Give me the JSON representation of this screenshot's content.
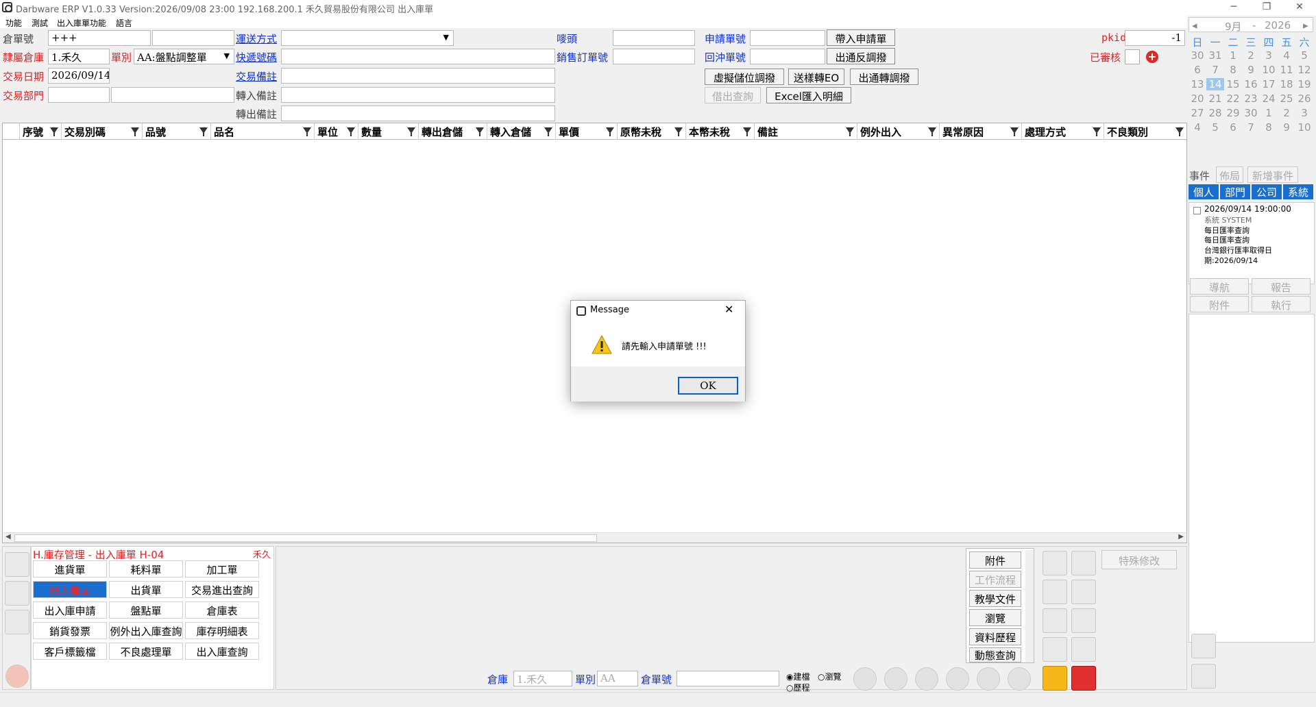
{
  "window": {
    "title": "Darbware ERP V1.0.33 Version:2026/09/08 23:00   192.168.200.1 禾久貿易股份有限公司 出入庫單",
    "minimize": "─",
    "restore": "❐",
    "close": "✕"
  },
  "menu": [
    "功能",
    "測試",
    "出入庫單功能",
    "語言"
  ],
  "form": {
    "warehouse_no_label": "倉單號",
    "warehouse_no_value": "+++",
    "warehouse_no_value2": "",
    "belong_wh_label": "隸屬倉庫",
    "belong_wh_value": "1.禾久",
    "doc_type_label": "單別",
    "doc_type_value": "AA:盤點調整單",
    "trade_date_label": "交易日期",
    "trade_date_value": "2026/09/14",
    "trade_dept_label": "交易部門",
    "trade_dept_value": "",
    "trade_dept_value2": "",
    "ship_method_label": "運送方式",
    "ship_method_value": "",
    "express_no_label": "快遞號碼",
    "express_no_value": "",
    "trade_note_label": "交易備註",
    "trade_note_value": "",
    "in_note_label": "轉入備註",
    "in_note_value": "",
    "out_note_label": "轉出備註",
    "out_note_value": "",
    "mark_label": "嘜頭",
    "mark_value": "",
    "sales_order_label": "銷售訂單號",
    "sales_order_value": "",
    "apply_no_label": "申請單號",
    "apply_no_value": "",
    "offset_no_label": "回沖單號",
    "offset_no_value": "",
    "pkid_label": "pkid",
    "pkid_value": "-1",
    "reviewed_label": "已審核",
    "btn_import_apply": "帶入申請單",
    "btn_out_reverse": "出通反調撥",
    "btn_virtual_store": "虛擬儲位調撥",
    "btn_sample_eo": "送樣轉EO",
    "btn_out_transfer": "出通轉調撥",
    "btn_lend_query": "借出查詢",
    "btn_excel_import": "Excel匯入明細"
  },
  "grid": {
    "columns": [
      "序號",
      "交易別碼",
      "品號",
      "品名",
      "單位",
      "數量",
      "轉出倉儲",
      "轉入倉儲",
      "單價",
      "原幣未稅",
      "本幣未稅",
      "備註",
      "例外出入",
      "異常原因",
      "處理方式",
      "不良類別"
    ]
  },
  "module": {
    "title": "H.庫存管理 - 出入庫單  H-04",
    "company": "禾久",
    "items": [
      "進貨單",
      "耗料單",
      "加工單",
      "出入庫單",
      "出貨單",
      "交易進出查詢",
      "出入庫申請",
      "盤點單",
      "倉庫表",
      "銷貨發票",
      "例外出入庫查詢",
      "庫存明細表",
      "客戶標籤檔",
      "不良處理單",
      "出入庫查詢"
    ]
  },
  "side_buttons": [
    "附件",
    "工作流程",
    "教學文件",
    "瀏覽",
    "資料歷程",
    "動態查詢"
  ],
  "special_edit": "特殊修改",
  "nav": {
    "wh_label": "倉庫",
    "wh_value": "1.禾久",
    "type_label": "單別",
    "type_value": "AA",
    "no_label": "倉單號",
    "no_value": "",
    "radio_current": "建檔",
    "radio_browse": "瀏覽",
    "radio_history": "歷程"
  },
  "calendar": {
    "month": "9月",
    "sep": "-",
    "year": "2026",
    "prev": "◂",
    "next": "▸",
    "dows": [
      "日",
      "一",
      "二",
      "三",
      "四",
      "五",
      "六"
    ],
    "days": [
      "30",
      "31",
      "1",
      "2",
      "3",
      "4",
      "5",
      "6",
      "7",
      "8",
      "9",
      "10",
      "11",
      "12",
      "13",
      "14",
      "15",
      "16",
      "17",
      "18",
      "19",
      "20",
      "21",
      "22",
      "23",
      "24",
      "25",
      "26",
      "27",
      "28",
      "29",
      "30",
      "1",
      "2",
      "3",
      "4",
      "5",
      "6",
      "7",
      "8",
      "9",
      "10"
    ],
    "today": "14"
  },
  "events": {
    "label": "事件",
    "layout_btn": "佈局",
    "new_btn": "新增事件",
    "tabs": [
      "個人",
      "部門",
      "公司",
      "系統"
    ],
    "item": {
      "time": "2026/09/14 19:00:00",
      "sender": "系統  SYSTEM",
      "title": "每日匯率查詢",
      "body": "每日匯率查詢\n台灣銀行匯率取得日期:2026/09/14"
    },
    "actions": [
      "導航",
      "報告",
      "附件",
      "執行"
    ]
  },
  "dialog": {
    "title": "Message",
    "message": "請先輸入申請單號 !!!",
    "ok": "OK",
    "close": "✕"
  },
  "colors": {
    "accent": "#1a6fce",
    "label_red": "#e02020",
    "label_blue": "#1030d0",
    "save_yellow": "#f5b818"
  }
}
